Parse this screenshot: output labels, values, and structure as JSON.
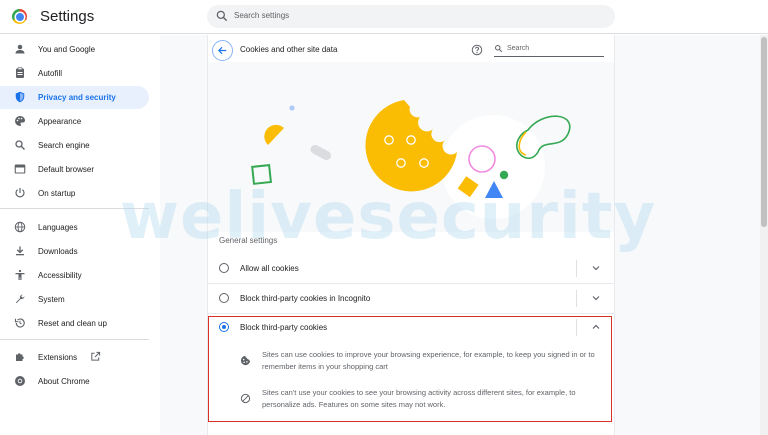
{
  "header": {
    "app_title": "Settings",
    "search_placeholder": "Search settings"
  },
  "sidebar": {
    "items": [
      {
        "label": "You and Google",
        "icon": "person-icon"
      },
      {
        "label": "Autofill",
        "icon": "clipboard-icon"
      },
      {
        "label": "Privacy and security",
        "icon": "shield-icon",
        "active": true
      },
      {
        "label": "Appearance",
        "icon": "palette-icon"
      },
      {
        "label": "Search engine",
        "icon": "search-icon"
      },
      {
        "label": "Default browser",
        "icon": "browser-icon"
      },
      {
        "label": "On startup",
        "icon": "power-icon"
      },
      {
        "label": "Languages",
        "icon": "globe-icon"
      },
      {
        "label": "Downloads",
        "icon": "download-icon"
      },
      {
        "label": "Accessibility",
        "icon": "accessibility-icon"
      },
      {
        "label": "System",
        "icon": "wrench-icon"
      },
      {
        "label": "Reset and clean up",
        "icon": "history-icon"
      },
      {
        "label": "Extensions",
        "icon": "puzzle-icon"
      },
      {
        "label": "About Chrome",
        "icon": "chrome-icon"
      }
    ]
  },
  "page": {
    "title": "Cookies and other site data",
    "search_placeholder": "Search",
    "section_label": "General settings"
  },
  "options": [
    {
      "label": "Allow all cookies",
      "selected": false,
      "expanded": false
    },
    {
      "label": "Block third-party cookies in Incognito",
      "selected": false,
      "expanded": false
    },
    {
      "label": "Block third-party cookies",
      "selected": true,
      "expanded": true
    }
  ],
  "details": [
    {
      "icon": "cookie-icon",
      "text": "Sites can use cookies to improve your browsing experience, for example, to keep you signed in or to remember items in your shopping cart"
    },
    {
      "icon": "block-icon",
      "text": "Sites can't use your cookies to see your browsing activity across different sites, for example, to personalize ads. Features on some sites may not work."
    }
  ],
  "watermark": "welivesecurity",
  "colors": {
    "accent": "#1a73e8",
    "active_bg": "#e8f0fe",
    "highlight_border": "#d93025",
    "cookie": "#fbbc04"
  }
}
